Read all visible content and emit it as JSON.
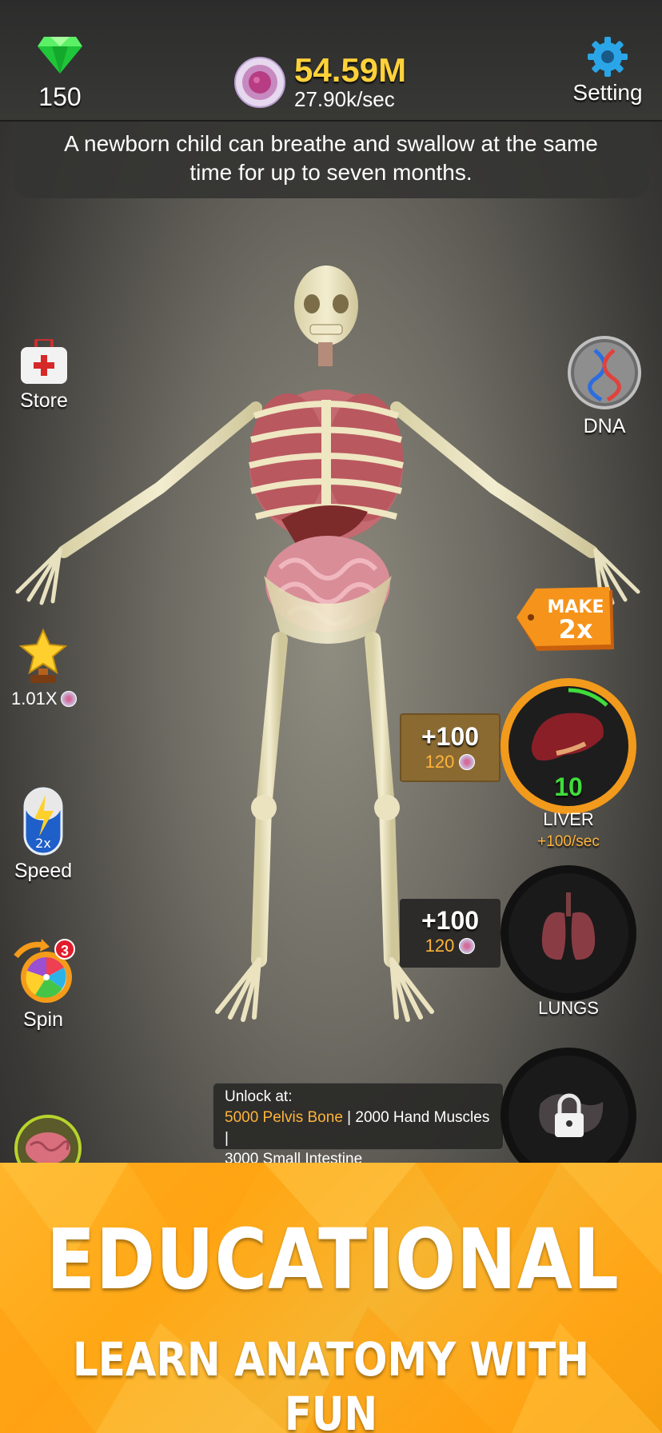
{
  "header": {
    "gems": "150",
    "currency_total": "54.59M",
    "currency_rate": "27.90k/sec",
    "setting_label": "Setting",
    "gem_icon": "green-gem-icon",
    "cell_icon": "cell-icon",
    "setting_icon": "gear-icon"
  },
  "fact": {
    "text": "A newborn child can breathe and swallow at the same time for up to seven months."
  },
  "left_menu": {
    "store_label": "Store",
    "trophy_label": "1.01X",
    "speed_badge": "2x",
    "speed_label": "Speed",
    "spin_label": "Spin",
    "spin_badge": "3"
  },
  "right_menu": {
    "dna_label": "DNA",
    "make_label": "MAKE",
    "make_value": "2x"
  },
  "organs": [
    {
      "name": "LIVER",
      "gain": "+100",
      "cost": "120",
      "level": "10",
      "rate": "+100/sec",
      "progress": 0.12
    },
    {
      "name": "LUNGS",
      "gain": "+100",
      "cost": "120"
    }
  ],
  "unlock": {
    "title": "Unlock at:",
    "req1": "5000 Pelvis Bone",
    "req2": " | 2000 Hand Muscles |",
    "req3": "3000 Small Intestine"
  },
  "banner": {
    "title": "EDUCATIONAL",
    "subtitle": "LEARN ANATOMY WITH FUN"
  },
  "colors": {
    "accent_gold": "#ffd23a",
    "liver_ring": "#f29a1c",
    "level_green": "#3fdc3c",
    "banner_orange": "#ffa715"
  }
}
